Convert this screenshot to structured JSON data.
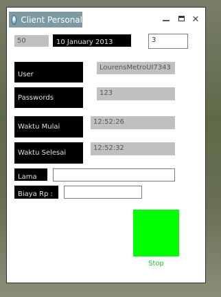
{
  "window": {
    "title": "Client Personal"
  },
  "top": {
    "count": "50",
    "date": "10 January 2013",
    "number": "3"
  },
  "fields": {
    "user_label": "User",
    "user_value": "LourensMetroUI7343",
    "passwords_label": "Passwords",
    "passwords_value": "123",
    "waktu_mulai_label": "Waktu Mulai",
    "waktu_mulai_value": "12:52:26",
    "waktu_selesai_label": "Waktu Selesai",
    "waktu_selesai_value": "12:52:32",
    "lama_label": "Lama",
    "lama_value": "",
    "biaya_label": "Biaya Rp :",
    "biaya_value": ""
  },
  "stop": {
    "label": "Stop",
    "color": "#00ff00"
  },
  "icons": {
    "app": "globe-icon",
    "minimize": "minimize-icon",
    "maximize": "maximize-icon",
    "close": "close-icon"
  }
}
